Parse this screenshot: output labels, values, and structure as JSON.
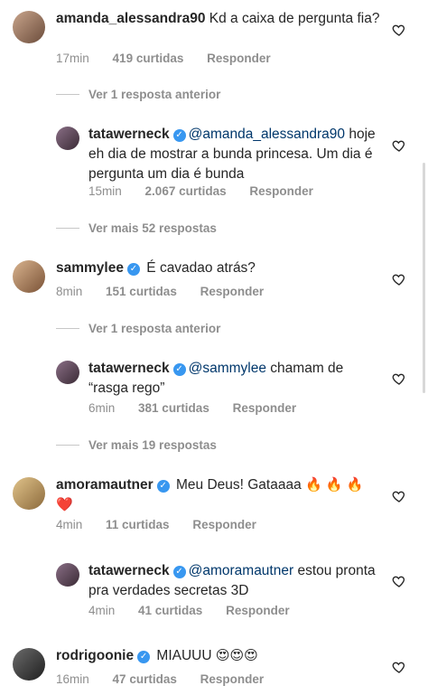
{
  "comments": [
    {
      "user": "amanda_alessandra90",
      "verified": false,
      "mention": "",
      "text": "Kd a caixa de pergunta fia?",
      "time": "17min",
      "likes": "419 curtidas",
      "reply": "Responder"
    },
    {
      "user": "tatawerneck",
      "verified": true,
      "mention": "@amanda_alessandra90",
      "text": "hoje eh dia de mostrar a bunda princesa. Um dia é pergunta um dia é bunda",
      "time": "15min",
      "likes": "2.067 curtidas",
      "reply": "Responder"
    },
    {
      "user": "sammylee",
      "verified": true,
      "mention": "",
      "text": "É cavadao atrás?",
      "time": "8min",
      "likes": "151 curtidas",
      "reply": "Responder"
    },
    {
      "user": "tatawerneck",
      "verified": true,
      "mention": "@sammylee",
      "text": "chamam de “rasga rego”",
      "time": "6min",
      "likes": "381 curtidas",
      "reply": "Responder"
    },
    {
      "user": "amoramautner",
      "verified": true,
      "mention": "",
      "text": "Meu Deus! Gataaaa",
      "emoji": "🔥 🔥 🔥 ❤️",
      "time": "4min",
      "likes": "11 curtidas",
      "reply": "Responder"
    },
    {
      "user": "tatawerneck",
      "verified": true,
      "mention": "@amoramautner",
      "text": "estou pronta pra verdades secretas 3D",
      "time": "4min",
      "likes": "41 curtidas",
      "reply": "Responder"
    },
    {
      "user": "rodrigoonie",
      "verified": true,
      "mention": "",
      "text": "MIAUUU",
      "emoji": "😍😍😍",
      "time": "16min",
      "likes": "47 curtidas",
      "reply": "Responder"
    }
  ],
  "threads": [
    "Ver 1 resposta anterior",
    "Ver mais 52 respostas",
    "Ver 1 resposta anterior",
    "Ver mais 19 respostas"
  ],
  "icons": {
    "heart": "heart-outline-icon",
    "verified": "verified-badge-icon"
  },
  "colors": {
    "verified": "#3897f0",
    "mention": "#00376b",
    "meta": "#8e8e8e"
  }
}
